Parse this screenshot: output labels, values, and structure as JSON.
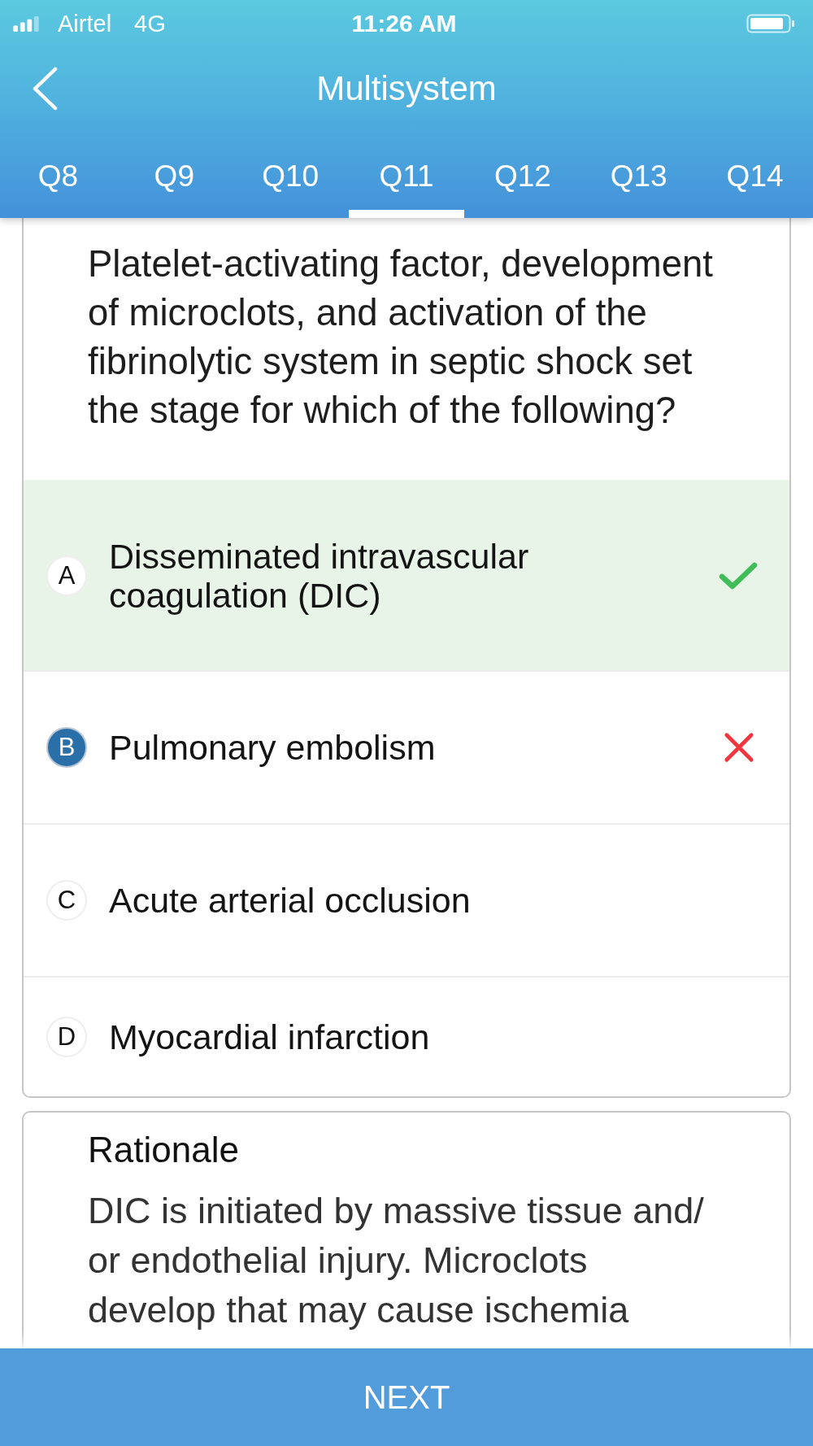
{
  "status_bar": {
    "carrier": "Airtel",
    "network": "4G",
    "time": "11:26 AM"
  },
  "header": {
    "title": "Multisystem"
  },
  "tabs": [
    {
      "label": "Q8",
      "selected": false
    },
    {
      "label": "Q9",
      "selected": false
    },
    {
      "label": "Q10",
      "selected": false
    },
    {
      "label": "Q11",
      "selected": true
    },
    {
      "label": "Q12",
      "selected": false
    },
    {
      "label": "Q13",
      "selected": false
    },
    {
      "label": "Q14",
      "selected": false
    }
  ],
  "question": {
    "text": "Platelet-activating factor, development of microclots, and activation of the fibrinolytic system in septic shock set the stage for which of the following?"
  },
  "options": [
    {
      "letter": "A",
      "text": "Disseminated intravascular coagulation (DIC)",
      "selected": false,
      "correct": true
    },
    {
      "letter": "B",
      "text": "Pulmonary embolism",
      "selected": true,
      "correct": false
    },
    {
      "letter": "C",
      "text": "Acute arterial occlusion",
      "selected": false,
      "correct": false
    },
    {
      "letter": "D",
      "text": "Myocardial infarction",
      "selected": false,
      "correct": false
    }
  ],
  "rationale": {
    "title": "Rationale",
    "text": "DIC is initiated by massive tissue and/ or endothelial injury. Microclots develop that may cause ischemia"
  },
  "next_button": {
    "label": "NEXT"
  }
}
